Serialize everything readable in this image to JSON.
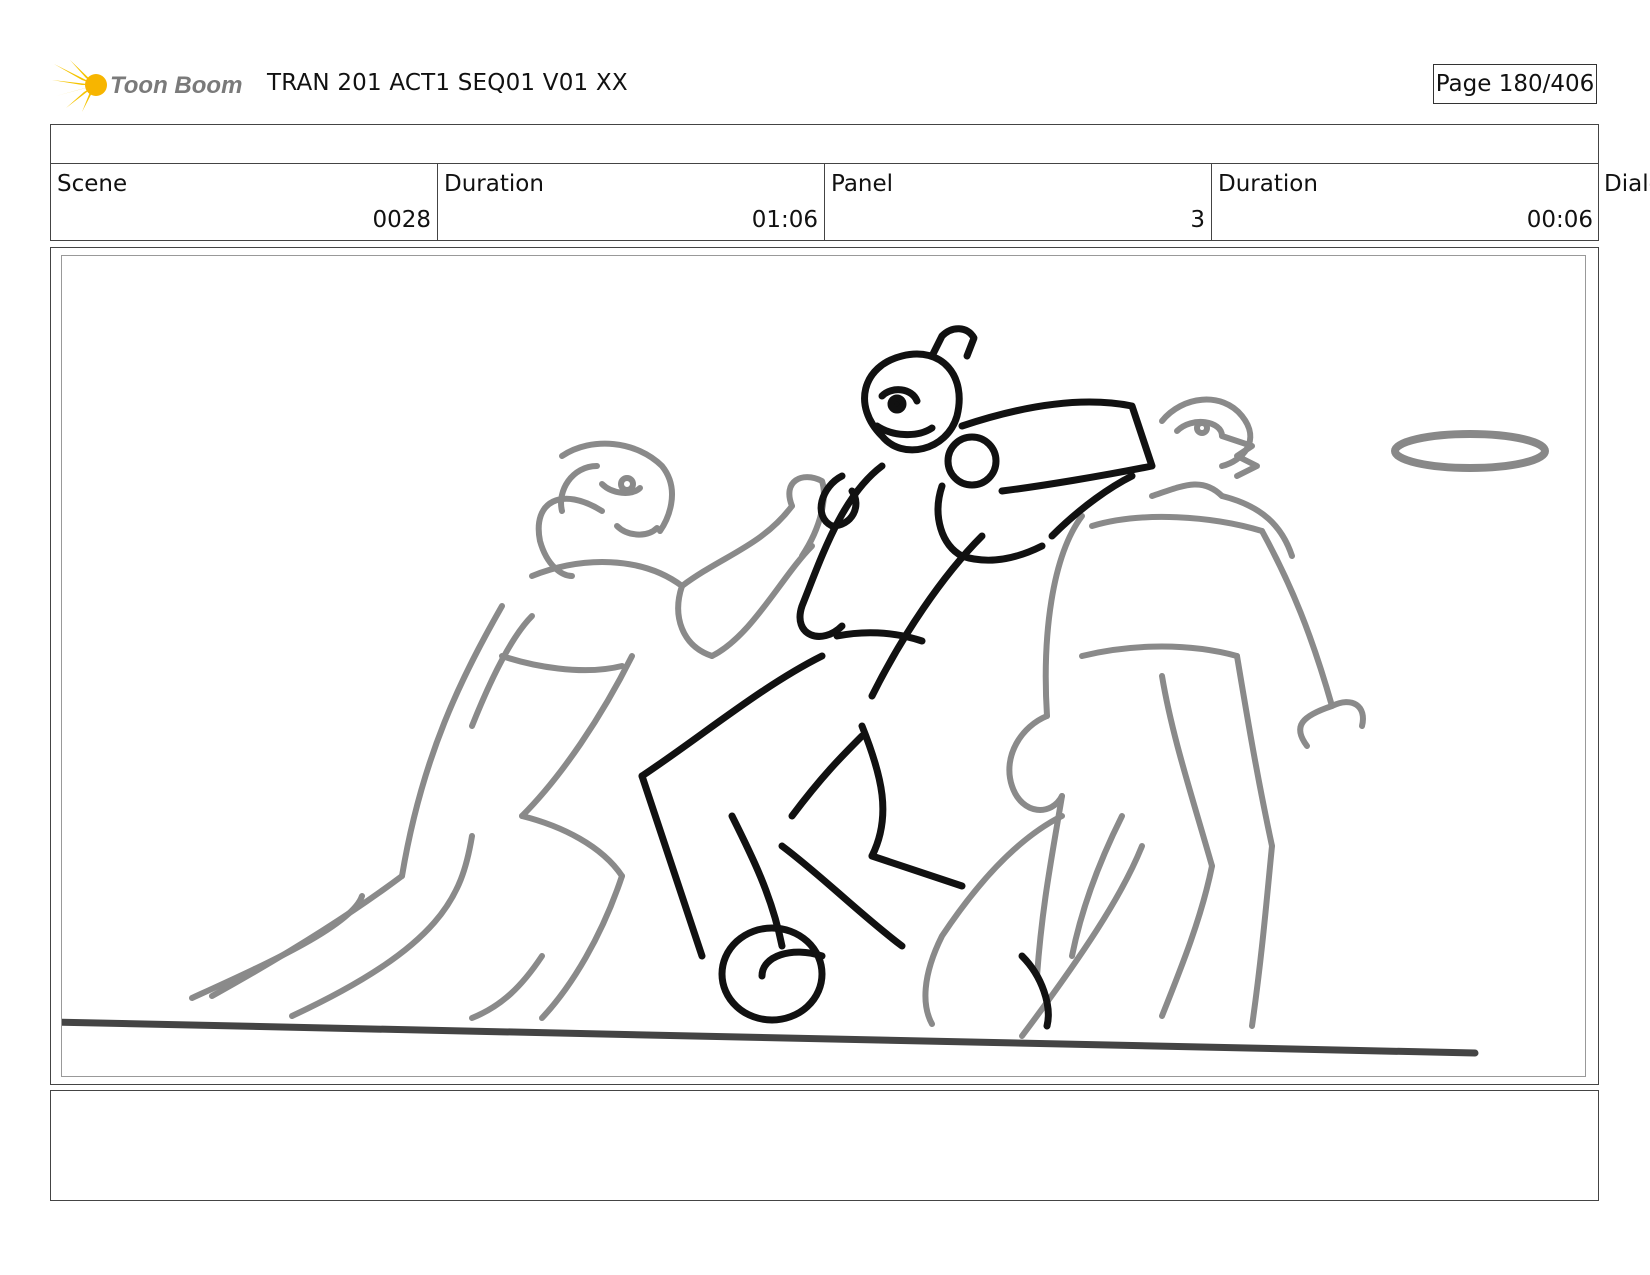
{
  "header": {
    "brand": "Toon Boom",
    "doc_title": "TRAN 201 ACT1 SEQ01 V01 XX",
    "page": "Page 180/406",
    "logo_icon": "sun-burst-icon",
    "logo_color": "#f5c400"
  },
  "info": {
    "scene_label": "Scene",
    "scene_value": "0028",
    "scene_duration_label": "Duration",
    "scene_duration_value": "01:06",
    "panel_label": "Panel",
    "panel_value": "3",
    "panel_duration_label": "Duration",
    "panel_duration_value": "00:06",
    "dialog_label": "Dialog"
  },
  "sketch": {
    "ink_dark": "#111111",
    "ink_gray": "#8a8a8a"
  },
  "dialog": {
    "text": ""
  }
}
